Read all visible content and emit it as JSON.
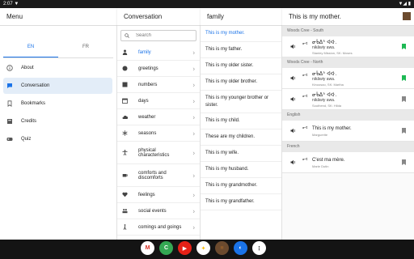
{
  "status": {
    "time": "2:07",
    "indicator": "▼",
    "right": "▼◢ ▮"
  },
  "sidebar": {
    "title": "Menu",
    "languages": [
      "EN",
      "FR"
    ],
    "items": [
      {
        "label": "About",
        "icon": "info-icon"
      },
      {
        "label": "Conversation",
        "icon": "chat-icon"
      },
      {
        "label": "Bookmarks",
        "icon": "bookmark-icon"
      },
      {
        "label": "Credits",
        "icon": "credits-icon"
      },
      {
        "label": "Quiz",
        "icon": "gamepad-icon"
      }
    ]
  },
  "categories": {
    "title": "Conversation",
    "search_placeholder": "Search",
    "items": [
      "family",
      "greetings",
      "numbers",
      "days",
      "weather",
      "seasons",
      "physical characteristics",
      "comforts and discomforts",
      "feelings",
      "social events",
      "comings and goings"
    ]
  },
  "phrases": {
    "title": "family",
    "items": [
      "This is my mother.",
      "This is my father.",
      "This is my older sister.",
      "This is my older brother.",
      "This is my younger brother or sister.",
      "This is my child.",
      "These are my children.",
      "This is my wife.",
      "This is my husband.",
      "This is my grandmother.",
      "This is my grandfather."
    ]
  },
  "detail": {
    "title": "This is my mother.",
    "sections": [
      {
        "heading": "Woods Cree - South",
        "entries": [
          {
            "main": "ᓂᑳᐏᔾ ᐊᐘ.",
            "sub": "nikâwiy awa.",
            "speaker": "Stanley Mission, SK: Moses",
            "bookmarked": true
          }
        ]
      },
      {
        "heading": "Woods Cree - North",
        "entries": [
          {
            "main": "ᓂᑳᐏᔾ ᐊᐘ.",
            "sub": "nikâwiy awa.",
            "speaker": "Kinoosao, SK: Martha",
            "bookmarked": true
          },
          {
            "main": "ᓂᑳᐏᔾ ᐊᐘ.",
            "sub": "nikâwiy awa.",
            "speaker": "Southend, SK: Hilda",
            "bookmarked": false
          }
        ]
      },
      {
        "heading": "English",
        "entries": [
          {
            "main": "This is my mother.",
            "sub": "",
            "speaker": "Marguerite",
            "bookmarked": false
          }
        ]
      },
      {
        "heading": "French",
        "entries": [
          {
            "main": "C'est ma mère.",
            "sub": "",
            "speaker": "Marie Dutin",
            "bookmarked": false
          }
        ]
      }
    ]
  },
  "colors": {
    "accent": "#1a73e8",
    "bookmark_on": "#1db954",
    "bookmark_off": "#888888"
  },
  "dock": [
    "M",
    "C",
    "▶",
    "✦",
    "■",
    "◐",
    "⋮"
  ]
}
